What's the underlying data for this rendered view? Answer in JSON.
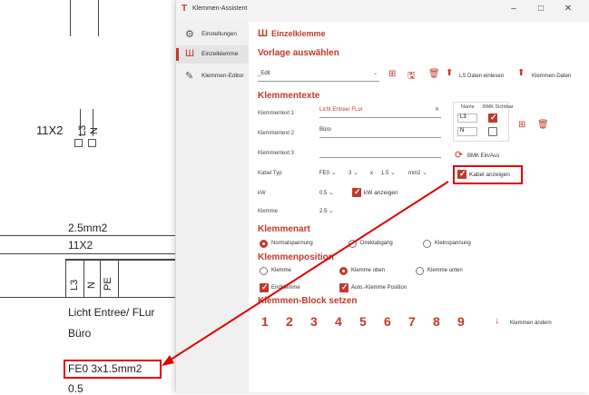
{
  "cad": {
    "label_11x2_top": "11X2",
    "top_terms": [
      "L3",
      "N"
    ],
    "label_2_5mm2": "2.5mm2",
    "label_11x2": "11X2",
    "terms": [
      "L3",
      "N",
      "PE"
    ],
    "text1": "Licht Entree/ FLur",
    "text2": "Büro",
    "cable": "FE0 3x1.5mm2",
    "kw": "0.5"
  },
  "window": {
    "title": "Klemmen-Assistent",
    "controls": [
      "–",
      "□",
      "✕"
    ]
  },
  "sidebar": {
    "items": [
      {
        "label": "Einstellungen",
        "icon": "gear-icon"
      },
      {
        "label": "Einzelklemme",
        "icon": "terminal-icon"
      },
      {
        "label": "Klemmen-Editor",
        "icon": "pencil-icon"
      }
    ]
  },
  "main": {
    "header": "Einzelklemme",
    "vorlage_title": "Vorlage auswählen",
    "vorlage_value": "_Edit",
    "ls_daten": "LS Daten einlesen",
    "klemmen_daten": "Klemmen-Daten",
    "klemmentexte_title": "Klemmentexte",
    "text1_label": "Klemmentext 1",
    "text1_value": "Licht Entree/ FLur",
    "text2_label": "Klemmentext 2",
    "text2_value": "Büro",
    "text3_label": "Klemmentext 3",
    "name_header": "Name",
    "bmk_header": "BMK Sichtbar",
    "name1": "L3",
    "name2": "N",
    "bmk_toggle": "BMK Ein/Aus",
    "kabel_label": "Kabel Typ",
    "kabel_type": "FE0",
    "kabel_cores": "3",
    "kabel_x": "x",
    "kabel_size": "1.5",
    "kabel_unit": "mm2",
    "kabel_show": "Kabel anzeigen",
    "kw_label": "kW",
    "kw_value": "0.5",
    "kw_show": "kW anzeigen",
    "klemme_label": "Klemme",
    "klemme_value": "2.5",
    "klemmenart_title": "Klemmenart",
    "art_options": [
      "Normalspannung",
      "Direktabgang",
      "Kleinspannung"
    ],
    "position_title": "Klemmenposition",
    "pos_options": [
      "Klemme",
      "Klemme oben",
      "Klemme unten"
    ],
    "endklemme": "Endklemme",
    "auto_pos": "Auto.-Klemme Position",
    "block_title": "Klemmen-Block setzen",
    "block_numbers": [
      "1",
      "2",
      "3",
      "4",
      "5",
      "6",
      "7",
      "8",
      "9"
    ],
    "klemmen_aendern": "Klemmen ändern"
  },
  "colors": {
    "accent": "#c0392b",
    "highlight": "#e00000"
  }
}
